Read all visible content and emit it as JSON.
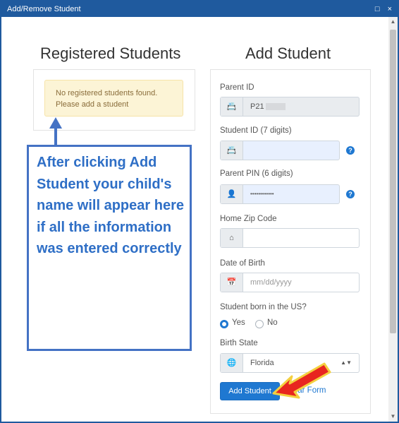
{
  "window": {
    "title": "Add/Remove Student",
    "controls": "□ ×"
  },
  "registered": {
    "heading": "Registered Students",
    "alert_line1": "No registered students found.",
    "alert_line2": "Please add a student"
  },
  "annotation": {
    "text": "After clicking Add Student your child's name will appear here if all the information was entered correctly"
  },
  "add_student": {
    "heading": "Add Student",
    "parent_id": {
      "label": "Parent ID",
      "value": "P21"
    },
    "student_id": {
      "label": "Student ID (7 digits)",
      "value": ""
    },
    "parent_pin": {
      "label": "Parent PIN (6 digits)",
      "value": "••••••••••••"
    },
    "zip": {
      "label": "Home Zip Code",
      "value": ""
    },
    "dob": {
      "label": "Date of Birth",
      "placeholder": "mm/dd/yyyy"
    },
    "born_us": {
      "label": "Student born in the US?",
      "options": [
        "Yes",
        "No"
      ],
      "selected": "Yes"
    },
    "birth_state": {
      "label": "Birth State",
      "selected": "Florida"
    },
    "submit_label": "Add Student",
    "clear_label": "Clear Form"
  },
  "icons": {
    "id_card": "id-card-icon",
    "pin": "user-lock-icon",
    "home": "home-icon",
    "calendar": "calendar-icon",
    "globe": "globe-icon",
    "help": "?"
  },
  "colors": {
    "titlebar": "#1f5a9e",
    "primary": "#1f78d1",
    "annotation_border": "#4472c4",
    "annotation_text": "#2f6fc6",
    "alert_bg": "#fcf4d6",
    "arrow_fill": "#e8261f",
    "arrow_stroke": "#f4d03f"
  }
}
